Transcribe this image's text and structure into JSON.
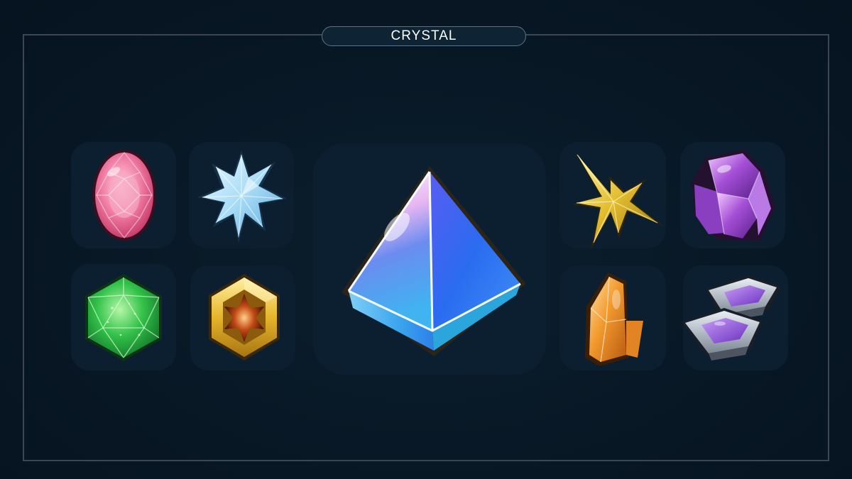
{
  "header": {
    "title": "CRYSTAL"
  },
  "crystals": [
    {
      "icon": "pink-oval-gem-icon",
      "color": "#f07aa2"
    },
    {
      "icon": "ice-star-crystal-icon",
      "color": "#b9e6fb"
    },
    {
      "icon": "green-hexagon-gem-icon",
      "color": "#2fc84a"
    },
    {
      "icon": "gold-hexagon-fire-gem-icon",
      "color": "#e9b72a"
    },
    {
      "icon": "blue-prism-crystal-icon",
      "color": "#3a6ff0"
    },
    {
      "icon": "gold-spiky-star-icon",
      "color": "#e7c43a"
    },
    {
      "icon": "purple-amethyst-cluster-icon",
      "color": "#9b3fcf"
    },
    {
      "icon": "orange-quartz-shard-icon",
      "color": "#f29a2e"
    },
    {
      "icon": "silver-purple-plates-icon",
      "color": "#8e5ce0"
    }
  ]
}
